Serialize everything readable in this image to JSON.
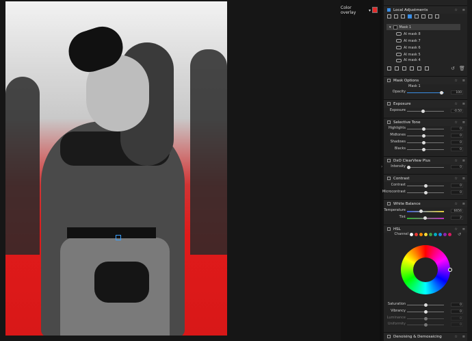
{
  "toolbar": {
    "overlay_label": "Color overlay",
    "overlay_color": "#e22b2b"
  },
  "local_adjustments": {
    "title": "Local Adjustments",
    "masks": [
      {
        "label": "Mask 1"
      },
      {
        "label": "AI mask 8"
      },
      {
        "label": "AI mask 7"
      },
      {
        "label": "AI mask 6"
      },
      {
        "label": "AI mask 5"
      },
      {
        "label": "AI mask 4"
      }
    ]
  },
  "mask_options": {
    "title": "Mask Options",
    "mask_name": "Mask 1",
    "opacity_label": "Opacity",
    "opacity_value": "100"
  },
  "exposure": {
    "title": "Exposure",
    "label": "Exposure",
    "value": "-0.50"
  },
  "selective_tone": {
    "title": "Selective Tone",
    "rows": [
      {
        "label": "Highlights",
        "value": "0"
      },
      {
        "label": "Midtones",
        "value": "0"
      },
      {
        "label": "Shadows",
        "value": "0"
      },
      {
        "label": "Blacks",
        "value": "0"
      }
    ]
  },
  "clearview": {
    "title": "DxO ClearView Plus",
    "label": "Intensity",
    "value": "0"
  },
  "contrast": {
    "title": "Contrast",
    "rows": [
      {
        "label": "Contrast",
        "value": "0"
      },
      {
        "label": "Microcontrast",
        "value": "0"
      }
    ]
  },
  "white_balance": {
    "title": "White Balance",
    "rows": [
      {
        "label": "Temperature",
        "value": "6656"
      },
      {
        "label": "Tint",
        "value": "2"
      }
    ]
  },
  "hsl": {
    "title": "HSL",
    "channel_label": "Channel",
    "channel_colors": [
      "#ffffff",
      "#e53935",
      "#fb8c00",
      "#fdd835",
      "#43a047",
      "#00acc1",
      "#1e88e5",
      "#8e24aa",
      "#d81b60"
    ],
    "rows": [
      {
        "label": "Saturation",
        "value": "0"
      },
      {
        "label": "Vibrancy",
        "value": "0"
      },
      {
        "label": "Luminance",
        "value": "0"
      },
      {
        "label": "Uniformity",
        "value": "0"
      }
    ]
  },
  "denoising": {
    "title": "Denoising & Demosaicing"
  }
}
